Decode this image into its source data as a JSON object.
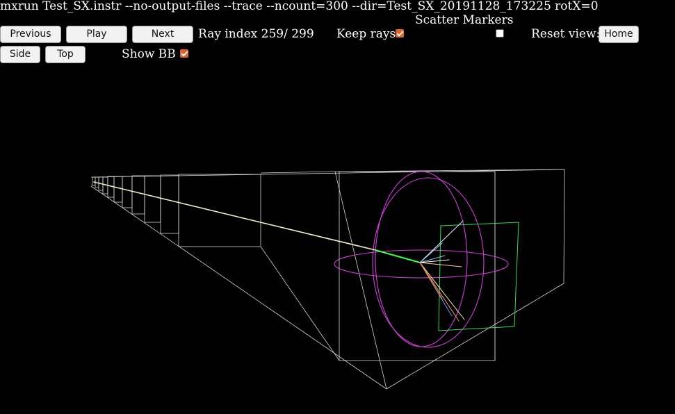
{
  "window": {
    "title": "mxrun Test_SX.instr --no-output-files --trace --ncount=300 --dir=Test_SX_20191128_173225 rotX=0"
  },
  "controls": {
    "previous_label": "Previous",
    "play_label": "Play",
    "next_label": "Next",
    "ray_index_label": "Ray index",
    "ray_index_value": "259/ 299",
    "keep_rays_label": "Keep rays",
    "keep_rays_checked": true,
    "scatter_markers_label": "Scatter Markers",
    "scatter_markers_checked": false,
    "reset_view_label": "Reset view:",
    "home_label": "Home",
    "side_label": "Side",
    "top_label": "Top",
    "show_bb_label": "Show BB",
    "show_bb_checked": true
  },
  "colors": {
    "background": "#000000",
    "bounding_box": "#d8d8d8",
    "sample_sphere": "#d040d8",
    "detector": "#30e060",
    "ray": "#f4ecc8",
    "ray_highlight": "#3cff3c",
    "checkbox_accent": "#e0612a"
  }
}
